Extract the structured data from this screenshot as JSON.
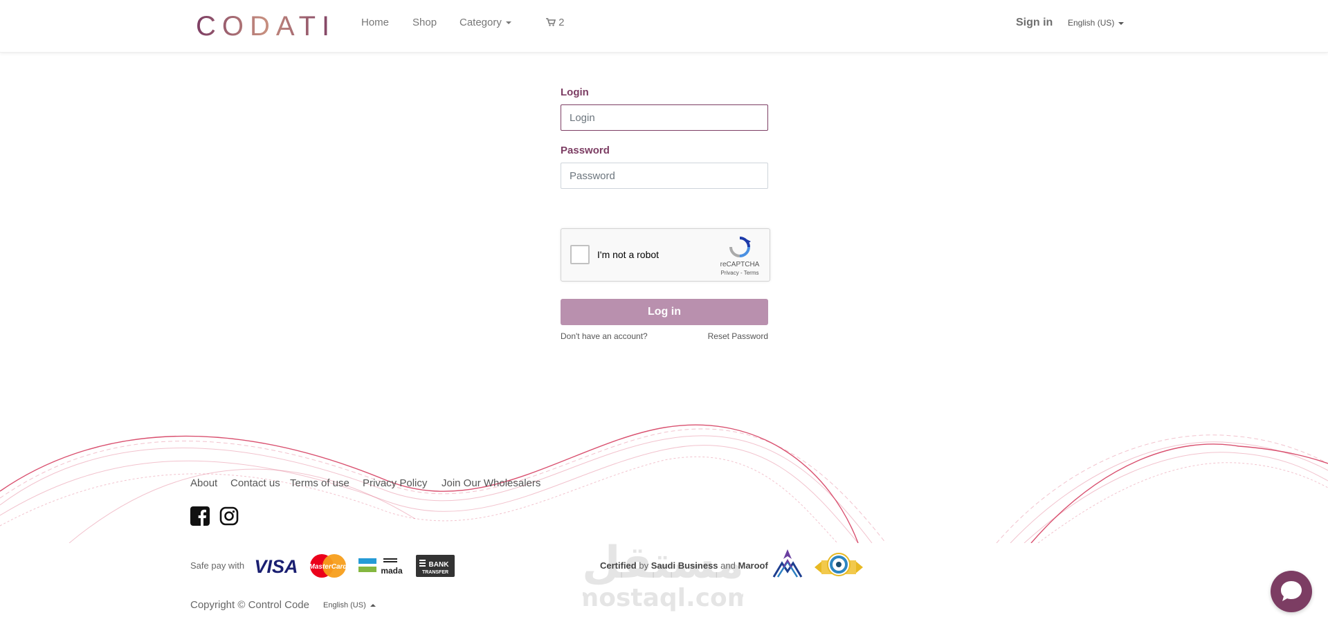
{
  "header": {
    "logo_text": "CODATI",
    "nav": {
      "home": "Home",
      "shop": "Shop",
      "category": "Category",
      "cart_count": "2"
    },
    "signin": "Sign in",
    "language": "English (US)"
  },
  "form": {
    "login_label": "Login",
    "login_placeholder": "Login",
    "password_label": "Password",
    "password_placeholder": "Password",
    "captcha_text": "I'm not a robot",
    "captcha_brand": "reCAPTCHA",
    "captcha_links": "Privacy - Terms",
    "submit": "Log in",
    "no_account": "Don't have an account?",
    "reset": "Reset Password"
  },
  "footer": {
    "links": [
      "About",
      "Contact us",
      "Terms of use",
      "Privacy Policy",
      "Join Our Wholesalers"
    ],
    "social": [
      "facebook-icon",
      "instagram-icon"
    ],
    "safe_pay": "Safe pay with",
    "payment_methods": [
      "VISA",
      "MasterCard",
      "mada",
      "BANK TRANSFER"
    ],
    "certified_prefix": "Certified",
    "certified_by": "by",
    "certified_org1": "Saudi Business",
    "certified_and": "and",
    "certified_org2": "Maroof",
    "copyright": "Copyright © Control Code",
    "language": "English (US)"
  },
  "watermark": {
    "arabic": "مستقل",
    "latin": "mostaql.com"
  },
  "colors": {
    "brand": "#7c3d63",
    "button": "#b990ae",
    "wave": "#d9506f"
  }
}
